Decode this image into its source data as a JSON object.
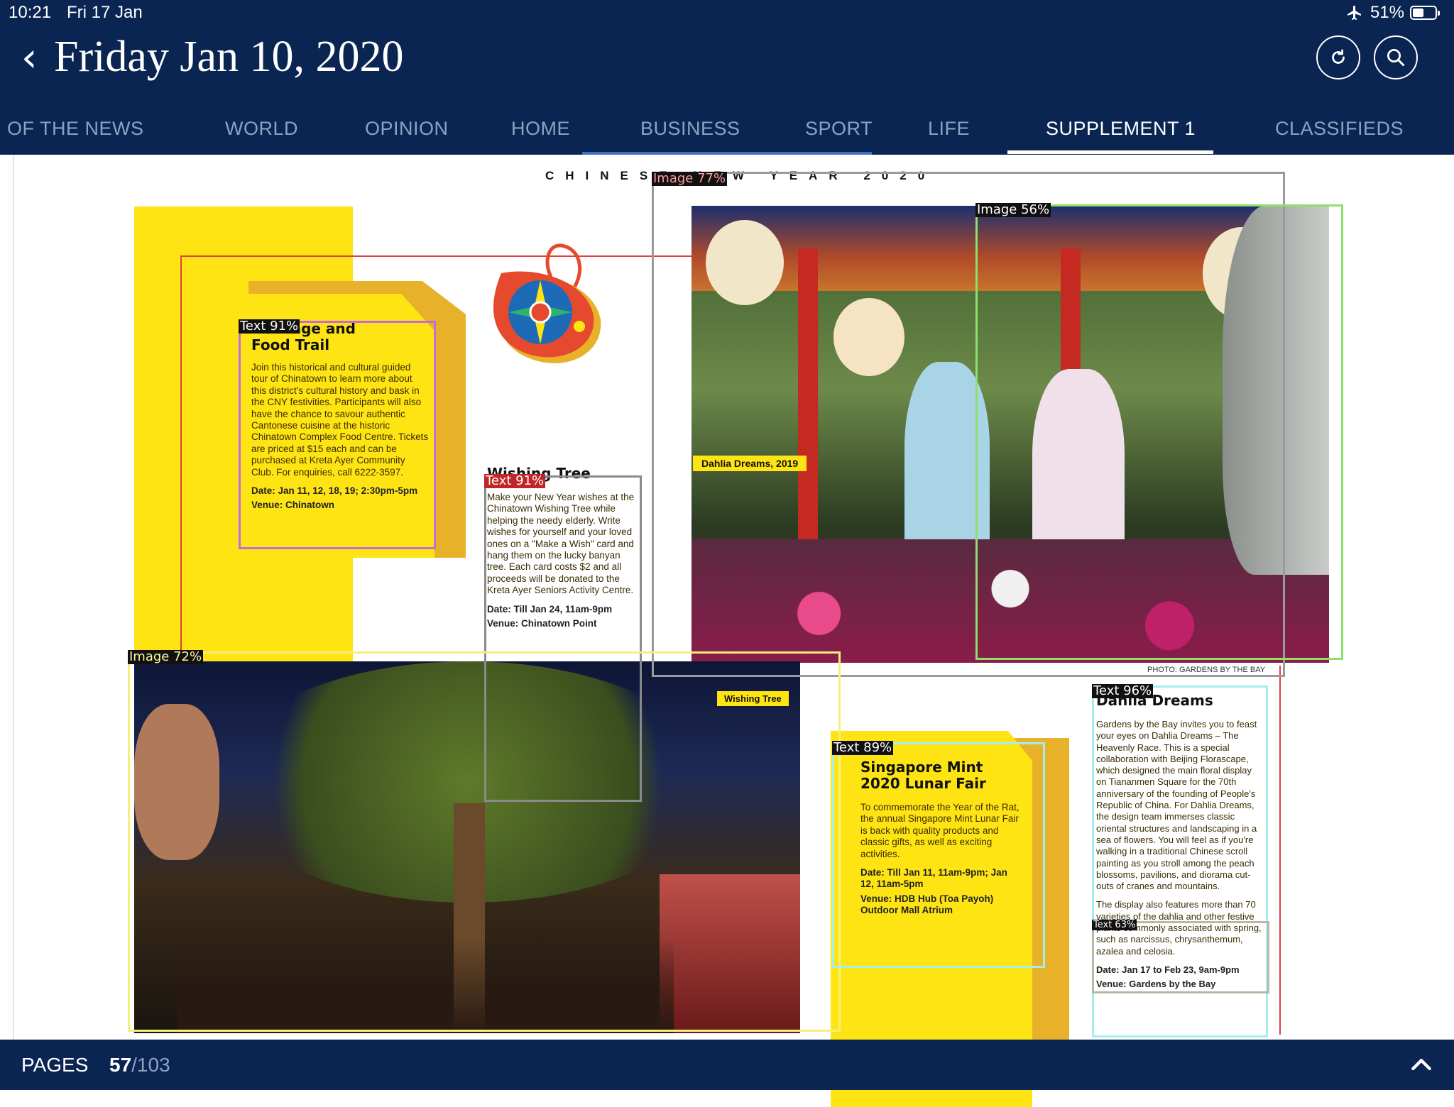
{
  "status_bar": {
    "time": "10:21",
    "date": "Fri 17 Jan",
    "battery": "51%",
    "battery_level": 0.51
  },
  "header": {
    "title": "Friday Jan 10, 2020"
  },
  "tabs": [
    "OF THE NEWS",
    "WORLD",
    "OPINION",
    "HOME",
    "BUSINESS",
    "SPORT",
    "LIFE",
    "SUPPLEMENT 1",
    "CLASSIFIEDS"
  ],
  "active_tab": "SUPPLEMENT 1",
  "footer": {
    "pages_label": "PAGES",
    "current_page": "57",
    "total_pages": "/103"
  },
  "page": {
    "spread_title": "CHINESE NEW YEAR 2020",
    "heritage": {
      "title_line1": "Heritage and",
      "title_line2": "Food Trail",
      "body": "Join this historical and cultural guided tour of Chinatown to learn more about this district's cultural history and bask in the CNY festivities. Participants will also have the chance to savour authentic Cantonese cuisine at the historic Chinatown Complex Food Centre. Tickets are priced at $15 each and can be purchased at Kreta Ayer Community Club. For enquiries, call 6222-3597.",
      "date": "Date: Jan 11, 12, 18, 19; 2:30pm-5pm",
      "venue": "Venue: Chinatown"
    },
    "wishing": {
      "title": "Wishing Tree",
      "body": "Make your New Year wishes at the Chinatown Wishing Tree while helping the needy elderly. Write wishes for yourself and your loved ones on a \"Make a Wish\" card and hang them on the lucky banyan tree. Each card costs $2 and all proceeds will be donated to the Kreta Ayer Seniors Activity Centre.",
      "date": "Date: Till Jan 24, 11am-9pm",
      "venue": "Venue: Chinatown Point"
    },
    "dahlia_photo_caption": "Dahlia Dreams, 2019",
    "photo_credit": "PHOTO: GARDENS BY THE BAY",
    "wishing_photo_caption": "Wishing Tree",
    "lunar": {
      "title_line1": "Singapore Mint",
      "title_line2": "2020 Lunar Fair",
      "body": "To commemorate the Year of the Rat, the annual Singapore Mint Lunar Fair is back with quality products and classic gifts, as well as exciting activities.",
      "date": "Date: Till Jan 11, 11am-9pm; Jan 12, 11am-5pm",
      "venue": "Venue: HDB Hub (Toa Payoh) Outdoor Mall Atrium"
    },
    "dahlia": {
      "title": "Dahlia Dreams",
      "body": "Gardens by the Bay invites you to feast your eyes on Dahlia Dreams – The Heavenly Race. This is a special collaboration with Beijing Florascape, which designed the main floral display on Tiananmen Square for the 70th anniversary of the founding of People's Republic of China. For Dahlia Dreams, the design team immerses classic oriental structures and landscaping in a sea of flowers. You will feel as if you're walking in a traditional Chinese scroll painting as you stroll among the peach blossoms, pavilions, and diorama cut-outs of cranes and mountains.",
      "body2": "The display also features more than 70 varieties of the dahlia and other festive plants commonly associated with spring, such as narcissus, chrysanthemum, azalea and celosia.",
      "date": "Date: Jan 17 to Feb 23, 9am-9pm",
      "venue": "Venue: Gardens by the Bay"
    }
  },
  "overlays": [
    {
      "label": "Text 91%",
      "color": "#c46be0"
    },
    {
      "label": "Text 91%",
      "color": "#8a8a8a"
    },
    {
      "label": "Image 77%",
      "color": "#9a9a9a"
    },
    {
      "label": "Image 56%",
      "color": "#8fe06a"
    },
    {
      "label": "Image 72%",
      "color": "#f5f07a"
    },
    {
      "label": "Text 89%",
      "color": "#a5eef0"
    },
    {
      "label": "Text 96%",
      "color": "#a5eef0"
    },
    {
      "label": "Text 63%",
      "color": "#b8b8a5"
    }
  ]
}
